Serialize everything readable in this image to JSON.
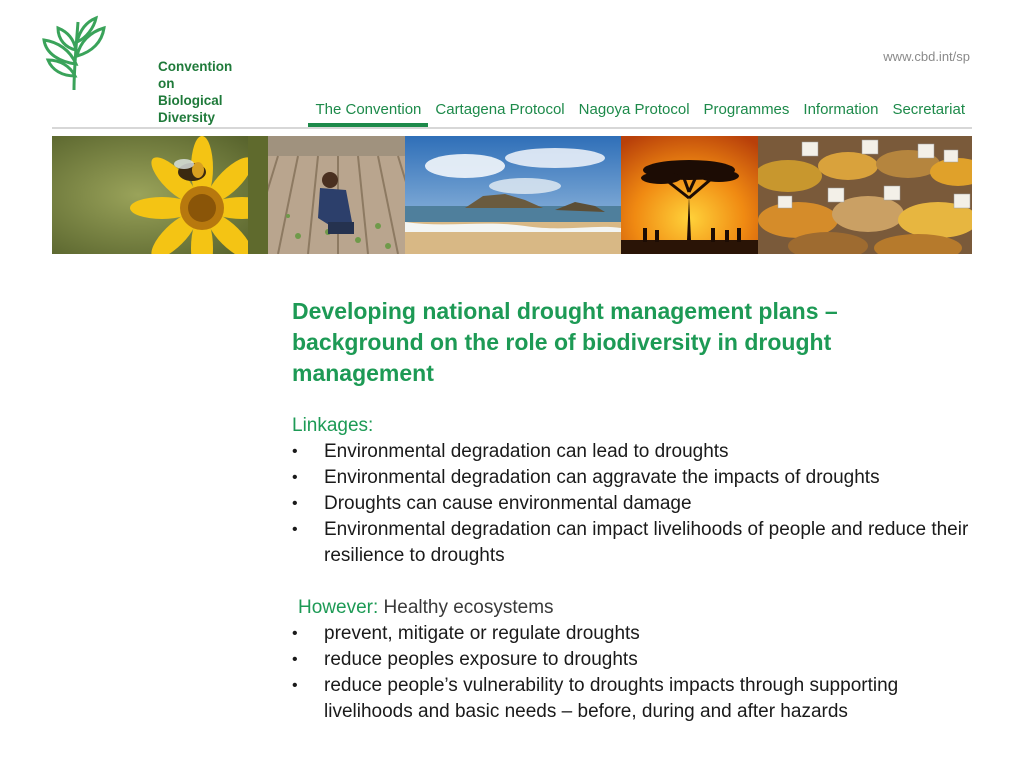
{
  "header": {
    "logo_line1": "Convention on",
    "logo_line2": "Biological Diversity",
    "site_url": "www.cbd.int/sp"
  },
  "nav": {
    "items": [
      {
        "label": "The Convention",
        "active": true
      },
      {
        "label": "Cartagena Protocol"
      },
      {
        "label": "Nagoya Protocol"
      },
      {
        "label": "Programmes"
      },
      {
        "label": "Information"
      },
      {
        "label": "Secretariat"
      }
    ]
  },
  "banner": {
    "photos": [
      "bee-on-flower",
      "farmer-in-field",
      "beach-rocks",
      "savanna-sunset",
      "spice-market"
    ]
  },
  "main": {
    "title": "Developing national drought management plans – background on the role of biodiversity in drought management",
    "linkages_label": "Linkages:",
    "linkages": [
      "Environmental degradation can lead to droughts",
      "Environmental degradation can aggravate the impacts of droughts",
      "Droughts can cause environmental damage",
      "Environmental degradation can impact livelihoods of people and reduce their resilience to droughts"
    ],
    "however_label": "However:",
    "however_text": "Healthy ecosystems",
    "benefits": [
      "prevent, mitigate or regulate droughts",
      "reduce peoples exposure to droughts",
      "reduce people’s vulnerability to droughts impacts through supporting livelihoods and basic needs – before, during and after hazards"
    ]
  },
  "colors": {
    "accent_green": "#1d9a55",
    "nav_green": "#1d8a4a",
    "logo_green": "#1f7a3a"
  }
}
